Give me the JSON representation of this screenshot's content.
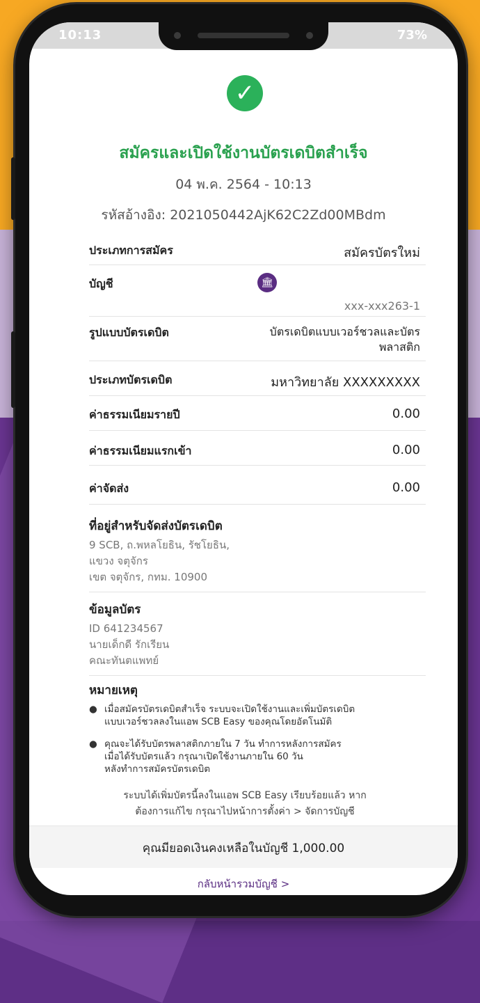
{
  "status_bar": {
    "time": "10:13",
    "right": "73%"
  },
  "header": {
    "title": "สมัครและเปิดใช้งานบัตรเดบิตสำเร็จ",
    "datetime": "04 พ.ค. 2564 - 10:13",
    "reference": "รหัสอ้างอิง: 2021050442AjK62C2Zd00MBdm"
  },
  "details": {
    "application_type": {
      "label": "ประเภทการสมัคร",
      "value": "สมัครบัตรใหม่"
    },
    "account": {
      "label": "บัญชี",
      "number": "xxx-xxx263-1"
    },
    "card_format": {
      "label": "รูปแบบบัตรเดบิต",
      "value_line1": "บัตรเดบิตแบบเวอร์ชวลและบัตร",
      "value_line2": "พลาสติก"
    },
    "card_type": {
      "label": "ประเภทบัตรเดบิต",
      "value": "มหาวิทยาลัย XXXXXXXXX"
    },
    "annual_fee": {
      "label": "ค่าธรรมเนียมรายปี",
      "value": "0.00"
    },
    "entry_fee": {
      "label": "ค่าธรรมเนียมแรกเข้า",
      "value": "0.00"
    },
    "shipping_fee": {
      "label": "ค่าจัดส่ง",
      "value": "0.00"
    }
  },
  "address": {
    "heading": "ที่อยู่สำหรับจัดส่งบัตรเดบิต",
    "line1": "9 SCB, ถ.พหลโยธิน, รัชโยธิน,",
    "line2": "แขวง จตุจักร",
    "line3": "เขต จตุจักร, กทม. 10900"
  },
  "card_info": {
    "heading": "ข้อมูลบัตร",
    "line1": "ID 641234567",
    "line2": "นายเด็กดี รักเรียน",
    "line3": "คณะทันตแพทย์"
  },
  "notes": {
    "heading": "หมายเหตุ",
    "item1_line1": "เมื่อสมัครบัตรเดบิตสำเร็จ ระบบจะเปิดใช้งานและเพิ่มบัตรเดบิต",
    "item1_line2": "แบบเวอร์ชวลลงในแอพ SCB Easy ของคุณโดยอัตโนมัติ",
    "item2_line1": "คุณจะได้รับบัตรพลาสติกภายใน 7 วัน ทำการหลังการสมัคร",
    "item2_line2": "เมื่อได้รับบัตรแล้ว กรุณาเปิดใช้งานภายใน 60 วัน",
    "item2_line3": "หลังทำการสมัครบัตรเดบิต"
  },
  "info": {
    "line1": "ระบบได้เพิ่มบัตรนี้ลงในแอพ SCB Easy เรียบร้อยแล้ว หาก",
    "line2": "ต้องการแก้ไข กรุณาไปหน้าการตั้งค่า > จัดการบัญชี"
  },
  "balance": {
    "text": "คุณมียอดเงินคงเหลือในบัญชี 1,000.00"
  },
  "back_link": "กลับหน้ารวมบัญชี >",
  "nav": {
    "back": "<",
    "home": "O",
    "recents": "|||"
  },
  "colors": {
    "success": "#2aa14f",
    "brand": "#5a2d82"
  }
}
